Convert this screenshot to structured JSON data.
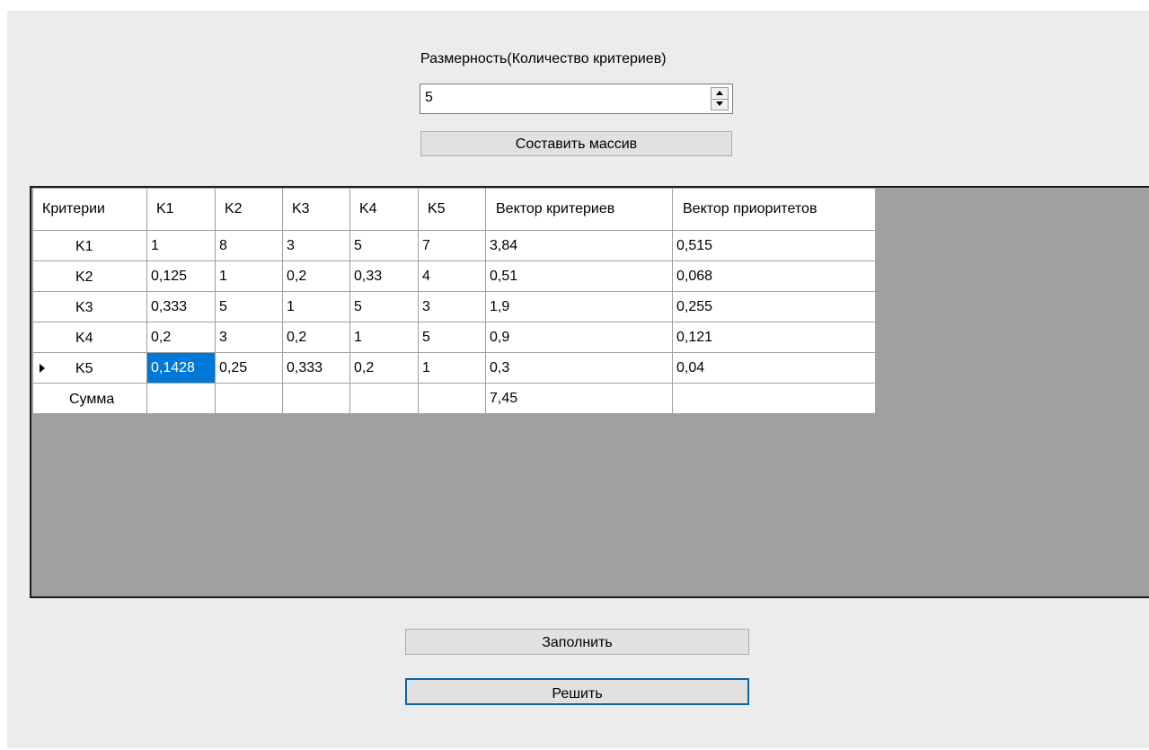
{
  "form": {
    "dimension_label": "Размерность(Количество критериев)",
    "dimension_value": "5",
    "build_button": "Составить массив",
    "fill_button": "Заполнить",
    "solve_button": "Решить"
  },
  "grid": {
    "columns": [
      "Критерии",
      "K1",
      "K2",
      "K3",
      "K4",
      "K5",
      "Вектор критериев",
      "Вектор приоритетов"
    ],
    "rows": [
      {
        "header": "K1",
        "cells": [
          "1",
          "8",
          "3",
          "5",
          "7",
          "3,84",
          "0,515"
        ]
      },
      {
        "header": "K2",
        "cells": [
          "0,125",
          "1",
          "0,2",
          "0,33",
          "4",
          "0,51",
          "0,068"
        ]
      },
      {
        "header": "K3",
        "cells": [
          "0,333",
          "5",
          "1",
          "5",
          "3",
          "1,9",
          "0,255"
        ]
      },
      {
        "header": "K4",
        "cells": [
          "0,2",
          "3",
          "0,2",
          "1",
          "5",
          "0,9",
          "0,121"
        ]
      },
      {
        "header": "K5",
        "cells": [
          "0,1428",
          "0,25",
          "0,333",
          "0,2",
          "1",
          "0,3",
          "0,04"
        ]
      },
      {
        "header": "Сумма",
        "cells": [
          "",
          "",
          "",
          "",
          "",
          "7,45",
          ""
        ]
      }
    ],
    "current_row_index": 4,
    "selected_cell": {
      "row": 4,
      "col": 0
    },
    "selection_color": "#0078d7"
  }
}
